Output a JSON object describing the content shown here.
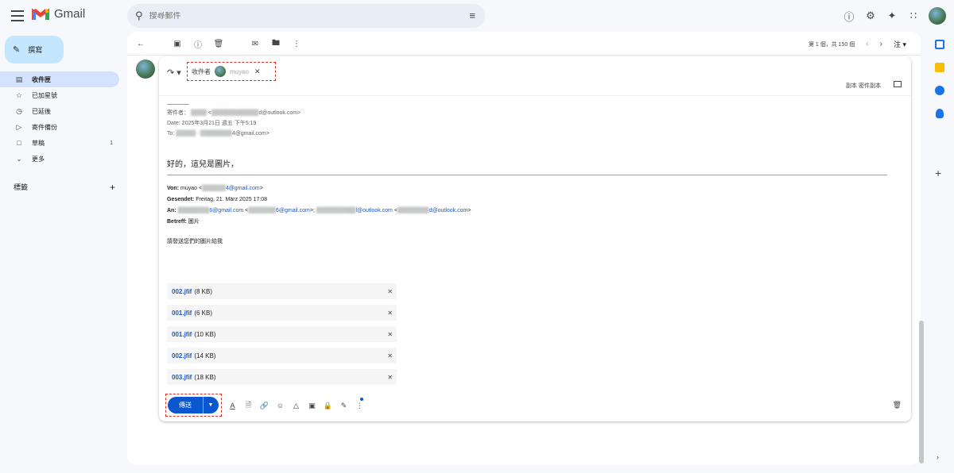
{
  "topbar": {
    "app_name": "Gmail",
    "search_placeholder": "搜尋郵件"
  },
  "sidebar": {
    "compose_label": "撰寫",
    "items": [
      {
        "label": "收件匣",
        "icon": "inbox-icon",
        "count": ""
      },
      {
        "label": "已加星號",
        "icon": "star-icon",
        "count": ""
      },
      {
        "label": "已延後",
        "icon": "clock-icon",
        "count": ""
      },
      {
        "label": "寄件備份",
        "icon": "send-icon",
        "count": ""
      },
      {
        "label": "草稿",
        "icon": "draft-icon",
        "count": "1"
      },
      {
        "label": "更多",
        "icon": "chevron-down-icon",
        "count": ""
      }
    ],
    "labels_heading": "標籤"
  },
  "toolbar": {
    "pager_text": "第 1 個，共 150 個",
    "lang": "注"
  },
  "compose": {
    "to_label": "收件者",
    "recipient_name": "muyao",
    "cc_links": "副本 密件副本",
    "forward_sender_line": "寄件者：",
    "forward_sender_rest": "<",
    "forward_sender_email_domain": "d@outlook.com>",
    "forward_date": "Date: 2025年3月21日 週五 下午5:19",
    "forward_to_prefix": "To: ",
    "forward_to_email_domain": "4@gmail.com>",
    "quote_heading": "好的，這兒是圖片，",
    "von_label": "Von:",
    "von_value": "muyao <",
    "von_email": "4@gmail.com",
    "von_close": ">",
    "gesendet_label": "Gesendet:",
    "gesendet_value": "Freitag, 21. März 2025 17:08",
    "an_label": "An:",
    "an_email1": "6@gmail.com",
    "an_email2": "6@gmail.com",
    "an_email3": "l@outlook.com",
    "an_email4": "d@outlook.com",
    "betreff_label": "Betreff:",
    "betreff_value": "圖片",
    "request_text": "請發送您們的圖片給我",
    "attachments": [
      {
        "name": "002.jfif",
        "size": "(8 KB)"
      },
      {
        "name": "001.jfif",
        "size": "(6 KB)"
      },
      {
        "name": "001.jfif",
        "size": "(10 KB)"
      },
      {
        "name": "002.jfif",
        "size": "(14 KB)"
      },
      {
        "name": "003.jfif",
        "size": "(18 KB)"
      }
    ],
    "send_label": "傳送"
  }
}
